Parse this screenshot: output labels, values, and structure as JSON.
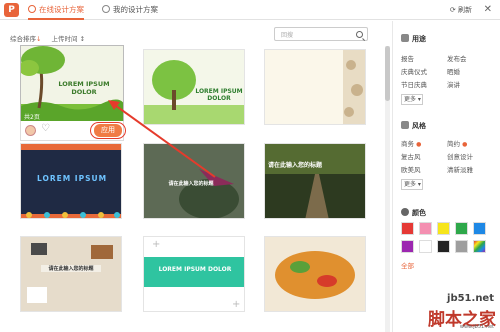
{
  "app": {
    "logo_text": "P"
  },
  "tabs": [
    {
      "label": "在线设计方案"
    },
    {
      "label": "我的设计方案"
    }
  ],
  "header": {
    "refresh_label": "刷新",
    "close_label": "✕"
  },
  "sort": {
    "label1": "综合排序",
    "label1_arrow": "↓",
    "label2": "上传时间",
    "label2_arrow": "↕"
  },
  "search": {
    "placeholder": "回搜"
  },
  "cards": [
    {
      "title": "LOREM IPSUM DOLOR",
      "count_text": "共2页"
    },
    {
      "title": "LOREM IPSUM DOLOR",
      "subtitle": ""
    },
    {
      "title": ""
    },
    {
      "title": "LOREM IPSUM"
    },
    {
      "title": "请在此输入您的标题"
    },
    {
      "title": "请在此输入您的标题"
    },
    {
      "title": "请在此输入您的标题"
    },
    {
      "title": "LOREM IPSUM DOLOR"
    },
    {
      "title": ""
    }
  ],
  "selected_card": {
    "apply_label": "应用",
    "heart": "♡"
  },
  "sidebar": {
    "usage": {
      "title": "用途",
      "items": [
        "报告",
        "发布会",
        "庆典仪式",
        "晒婚",
        "节日庆典",
        "演讲"
      ],
      "more": "更多"
    },
    "style": {
      "title": "风格",
      "items": [
        "商务",
        "简约",
        "复古风",
        "创意设计",
        "欧美风",
        "清新淡雅"
      ],
      "more": "更多"
    },
    "color": {
      "title": "颜色",
      "swatches": [
        "#e53935",
        "#f48fb1",
        "#f6e51c",
        "#2ea84a",
        "#1e88e5",
        "#9c27b0",
        "#ffffff",
        "#222222",
        "#9e9e9e",
        "#rainbow"
      ],
      "all_label": "全部"
    }
  },
  "watermark": {
    "line1": "jb51.net",
    "line2": "脚本之家",
    "line3": "www.jb51.net"
  }
}
